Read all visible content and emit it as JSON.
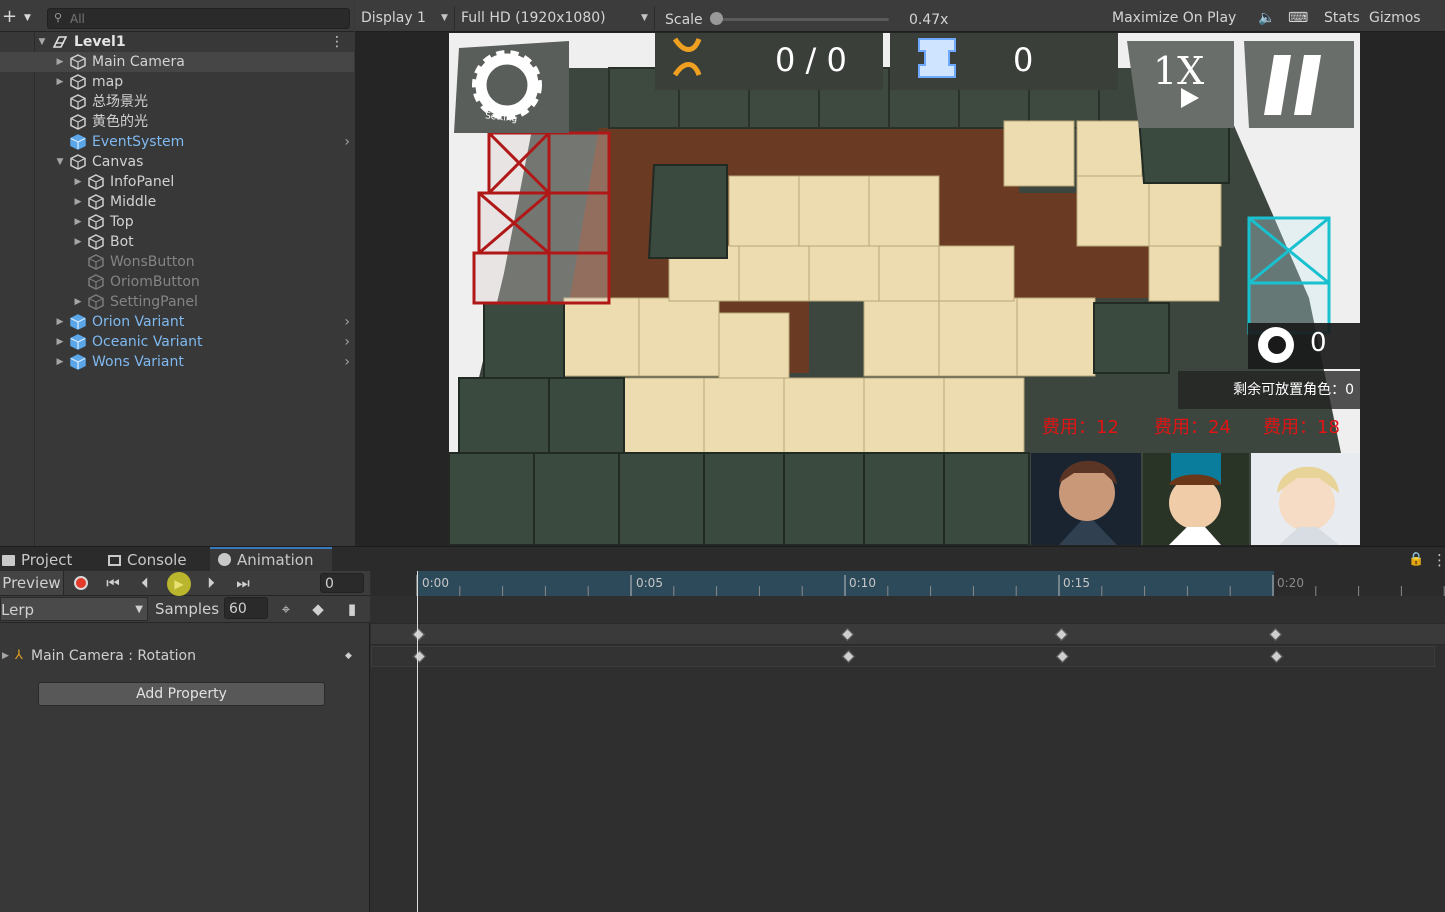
{
  "hierarchy": {
    "search_placeholder": "All",
    "items": [
      {
        "label": "Level1"
      },
      {
        "label": "Main Camera"
      },
      {
        "label": "map"
      },
      {
        "label": "总场景光"
      },
      {
        "label": "黄色的光"
      },
      {
        "label": "EventSystem"
      },
      {
        "label": "Canvas"
      },
      {
        "label": "InfoPanel"
      },
      {
        "label": "Middle"
      },
      {
        "label": "Top"
      },
      {
        "label": "Bot"
      },
      {
        "label": "WonsButton"
      },
      {
        "label": "OriomButton"
      },
      {
        "label": "SettingPanel"
      },
      {
        "label": "Orion Variant"
      },
      {
        "label": "Oceanic Variant"
      },
      {
        "label": "Wons Variant"
      }
    ]
  },
  "game_toolbar": {
    "display": "Display 1",
    "resolution": "Full HD (1920x1080)",
    "scale_label": "Scale",
    "scale_value": "0.47x",
    "maximize": "Maximize On Play",
    "stats": "Stats",
    "gizmos": "Gizmos"
  },
  "game": {
    "setting_label": "Setting",
    "enemy_count": "0 / 0",
    "life_count": "0",
    "speed_label": "1X",
    "operator_points": "0",
    "remaining_label": "剩余可放置角色：0",
    "costs": [
      "费用：12",
      "费用：24",
      "费用：18"
    ]
  },
  "dock_tabs": {
    "project": "Project",
    "console": "Console",
    "animation": "Animation"
  },
  "animation": {
    "preview": "Preview",
    "frame": "0",
    "interp": "Lerp",
    "samples_label": "Samples",
    "samples_value": "60",
    "property": "Main Camera : Rotation",
    "add_property": "Add Property",
    "ticks": [
      "0:00",
      "0:05",
      "0:10",
      "0:15",
      "0:20"
    ]
  }
}
